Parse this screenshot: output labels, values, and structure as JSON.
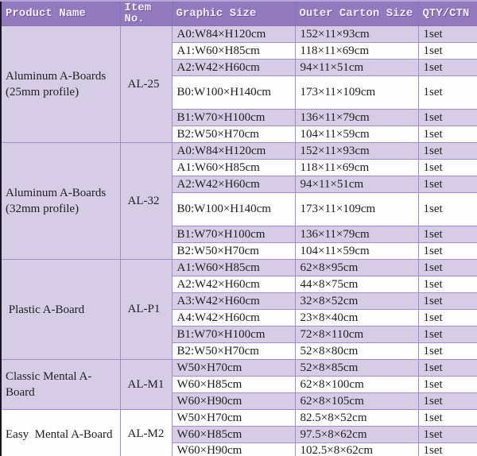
{
  "colors": {
    "header_bg": "#9379bd",
    "header_fg": "#f3effa",
    "row_stripe": "#d7cce5",
    "row_white": "#fdfdfe",
    "border": "#a28dc9",
    "outer_left": "#15151f",
    "outer_bottom": "#14142e"
  },
  "table": {
    "headers": [
      "Product Name",
      "Item No.",
      "Graphic Size",
      "Outer Carton Size",
      "QTY/CTN"
    ],
    "groups": [
      {
        "product": "Aluminum A-Boards (25mm profile)",
        "item_no": "AL-25",
        "rows": [
          {
            "graphic": "A0:W84×H120cm",
            "carton": "152×11×93cm",
            "qty": "1set",
            "tall": false
          },
          {
            "graphic": "A1:W60×H85cm",
            "carton": "118×11×69cm",
            "qty": "1set",
            "tall": false
          },
          {
            "graphic": "A2:W42×H60cm",
            "carton": "94×11×51cm",
            "qty": "1set",
            "tall": false
          },
          {
            "graphic": "B0:W100×H140cm",
            "carton": "173×11×109cm",
            "qty": "1set",
            "tall": true
          },
          {
            "graphic": "B1:W70×H100cm",
            "carton": "136×11×79cm",
            "qty": "1set",
            "tall": false
          },
          {
            "graphic": "B2:W50×H70cm",
            "carton": "104×11×59cm",
            "qty": "1set",
            "tall": false
          }
        ]
      },
      {
        "product": "Aluminum A-Boards (32mm profile)",
        "item_no": "AL-32",
        "rows": [
          {
            "graphic": "A0:W84×H120cm",
            "carton": "152×11×93cm",
            "qty": "1set",
            "tall": false
          },
          {
            "graphic": "A1:W60×H85cm",
            "carton": "118×11×69cm",
            "qty": "1set",
            "tall": false
          },
          {
            "graphic": "A2:W42×H60cm",
            "carton": "94×11×51cm",
            "qty": "1set",
            "tall": false
          },
          {
            "graphic": "B0:W100×H140cm",
            "carton": "173×11×109cm",
            "qty": "1set",
            "tall": true
          },
          {
            "graphic": "B1:W70×H100cm",
            "carton": "136×11×79cm",
            "qty": "1set",
            "tall": false
          },
          {
            "graphic": "B2:W50×H70cm",
            "carton": "104×11×59cm",
            "qty": "1set",
            "tall": false
          }
        ]
      },
      {
        "product": " Plastic A-Board",
        "item_no": "AL-P1",
        "rows": [
          {
            "graphic": "A1:W60×H85cm",
            "carton": "62×8×95cm",
            "qty": "1set",
            "tall": false
          },
          {
            "graphic": "A2:W42×H60cm",
            "carton": "44×8×75cm",
            "qty": "1set",
            "tall": false
          },
          {
            "graphic": "A3:W42×H60cm",
            "carton": "32×8×52cm",
            "qty": "1set",
            "tall": false
          },
          {
            "graphic": "A4:W42×H60cm",
            "carton": "23×8×40cm",
            "qty": "1set",
            "tall": false
          },
          {
            "graphic": "B1:W70×H100cm",
            "carton": "72×8×110cm",
            "qty": "1set",
            "tall": false
          },
          {
            "graphic": "B2:W50×H70cm",
            "carton": "52×8×80cm",
            "qty": "1set",
            "tall": false
          }
        ]
      },
      {
        "product": "Classic Mental A-Board",
        "item_no": "AL-M1",
        "rows": [
          {
            "graphic": "W50×H70cm",
            "carton": "52×8×85cm",
            "qty": "1set",
            "tall": false
          },
          {
            "graphic": "W60×H85cm",
            "carton": "62×8×100cm",
            "qty": "1set",
            "tall": false
          },
          {
            "graphic": "W60×H90cm",
            "carton": "62×8×105cm",
            "qty": "1set",
            "tall": false
          }
        ]
      },
      {
        "product": "Easy  Mental A-Board",
        "item_no": "AL-M2",
        "rows": [
          {
            "graphic": "W50×H70cm",
            "carton": "82.5×8×52cm",
            "qty": "1set",
            "tall": false
          },
          {
            "graphic": "W60×H85cm",
            "carton": "97.5×8×62cm",
            "qty": "1set",
            "tall": false
          },
          {
            "graphic": "W60×H90cm",
            "carton": "102.5×8×62cm",
            "qty": "1set",
            "tall": false
          }
        ]
      }
    ]
  }
}
